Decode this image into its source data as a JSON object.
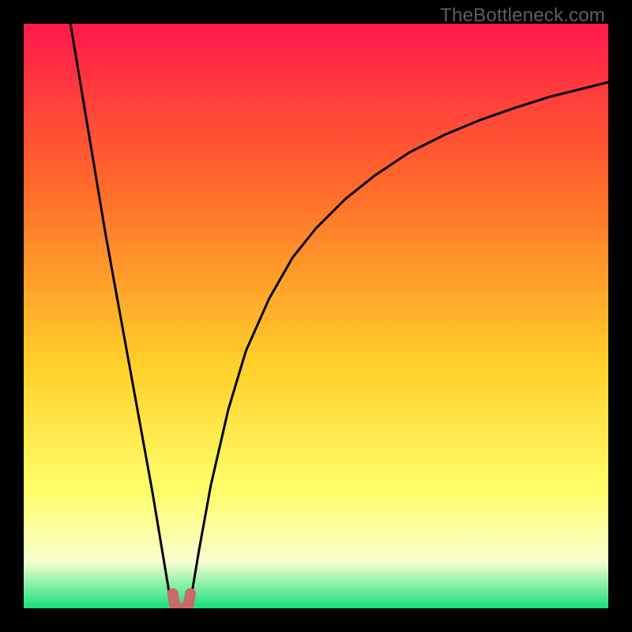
{
  "watermark": "TheBottleneck.com",
  "colors": {
    "top": "#ff1a4b",
    "upper_mid": "#ff6a2a",
    "mid": "#ffcf2a",
    "lower_mid": "#ffff6a",
    "pale": "#f8ffd0",
    "bottom": "#18e07a",
    "curve": "#000000",
    "marker": "#c96a6a",
    "frame": "#000000"
  },
  "chart_data": {
    "type": "line",
    "title": "",
    "xlabel": "",
    "ylabel": "",
    "xlim": [
      0,
      100
    ],
    "ylim": [
      0,
      100
    ],
    "series": [
      {
        "name": "left-branch",
        "x": [
          8,
          10,
          12,
          14,
          16,
          18,
          20,
          22,
          23.5,
          24.5,
          25,
          25.5
        ],
        "y": [
          100,
          88,
          76,
          64,
          53,
          42,
          31,
          20,
          11,
          5,
          2,
          1
        ]
      },
      {
        "name": "right-branch",
        "x": [
          28.5,
          29,
          30,
          32,
          35,
          38,
          42,
          46,
          50,
          55,
          60,
          66,
          72,
          78,
          84,
          90,
          96,
          100
        ],
        "y": [
          1,
          4,
          10,
          21,
          34,
          44,
          53,
          60,
          65,
          70,
          74,
          78,
          81,
          83.5,
          85.6,
          87.5,
          89,
          90
        ]
      },
      {
        "name": "valley-marker",
        "x": [
          25.5,
          25.8,
          26.5,
          27.5,
          28.2,
          28.5
        ],
        "y": [
          2.5,
          0.6,
          0,
          0,
          0.6,
          2.5
        ]
      }
    ],
    "gradient_bands_pct_from_top": [
      {
        "at": 0,
        "color": "top"
      },
      {
        "at": 28,
        "color": "upper_mid"
      },
      {
        "at": 58,
        "color": "mid"
      },
      {
        "at": 80,
        "color": "lower_mid"
      },
      {
        "at": 92,
        "color": "pale"
      },
      {
        "at": 100,
        "color": "bottom"
      }
    ]
  }
}
